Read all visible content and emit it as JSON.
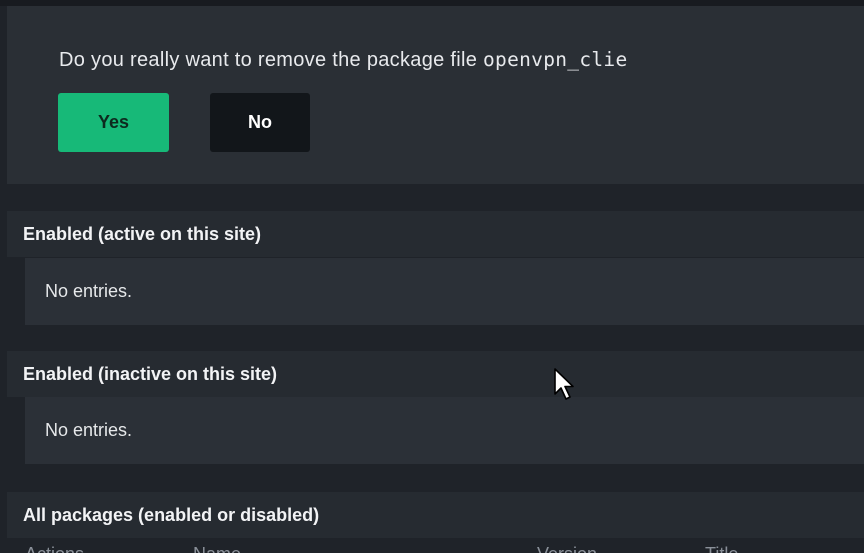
{
  "confirm": {
    "message": "Do you really want to remove the package file ",
    "filename": "openvpn_clie",
    "yes_label": "Yes",
    "no_label": "No"
  },
  "sections": [
    {
      "title": "Enabled (active on this site)",
      "empty_text": "No entries."
    },
    {
      "title": "Enabled (inactive on this site)",
      "empty_text": "No entries."
    },
    {
      "title": "All packages (enabled or disabled)"
    }
  ],
  "all_packages_columns": [
    "Actions",
    "Name",
    "Version",
    "Title"
  ],
  "colors": {
    "yes_button": "#17b978",
    "no_button": "#12161a",
    "background": "#1f2329"
  },
  "icons": {
    "cursor": "mouse-pointer-icon"
  }
}
